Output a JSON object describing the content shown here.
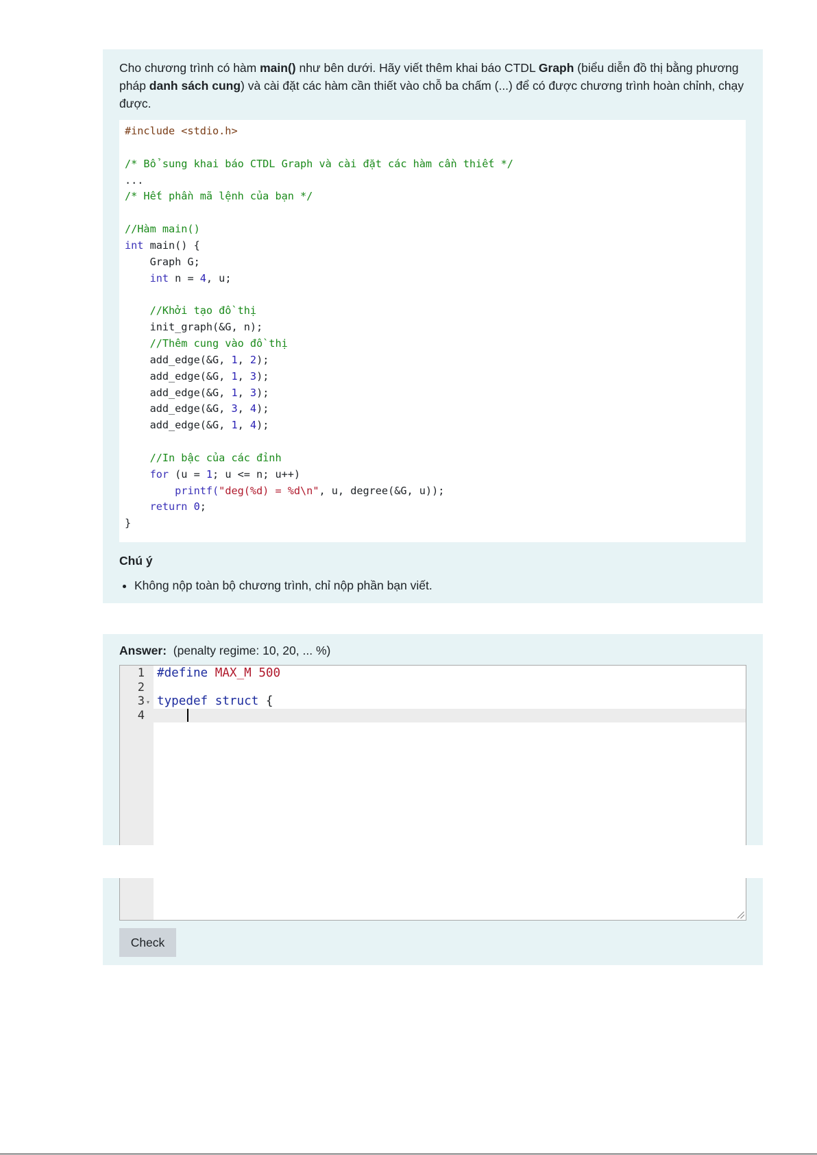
{
  "question": {
    "intro": {
      "p1": "Cho chương trình có hàm ",
      "b1": "main()",
      "p2": " như bên dưới. Hãy viết thêm khai báo CTDL ",
      "b2": "Graph",
      "p3": " (biểu diễn đồ thị bằng phương pháp ",
      "b3": "danh sách cung",
      "p4": ") và cài đặt các hàm cần thiết vào chỗ ba chấm (...) để có được chương trình hoàn chỉnh, chạy được."
    },
    "code": {
      "l1": "#include <stdio.h>",
      "l3": "/* Bổ sung khai báo CTDL Graph và cài đặt các hàm cần thiết */",
      "l4": "...",
      "l5": "/* Hết phần mã lệnh của bạn */",
      "l7": "//Hàm main()",
      "l8_kw": "int",
      "l8_rest": " main() {",
      "l9": "    Graph G;",
      "l10_kw": "int",
      "l10_a": " n = ",
      "l10_n": "4",
      "l10_b": ", u;",
      "l12": "//Khởi tạo đồ thị",
      "l13": "    init_graph(&G, n);",
      "l14": "//Thêm cung vào đồ thị",
      "edges": [
        {
          "a": "1",
          "b": "2"
        },
        {
          "a": "1",
          "b": "3"
        },
        {
          "a": "1",
          "b": "3"
        },
        {
          "a": "3",
          "b": "4"
        },
        {
          "a": "1",
          "b": "4"
        }
      ],
      "edge_prefix": "    add_edge(&G, ",
      "edge_sep": ", ",
      "edge_suffix": ");",
      "l21": "//In bậc của các đỉnh",
      "l22_kw": "for",
      "l22_a": " (u = ",
      "l22_n": "1",
      "l22_b": "; u <= n; u++)",
      "l23_fn": "printf(",
      "l23_str": "\"deg(%d) = %d\\n\"",
      "l23_rest": ", u, degree(&G, u));",
      "l24_kw": "return",
      "l24_n": "0",
      "l24_rest": ";",
      "l25": "}"
    },
    "note_title": "Chú ý",
    "note_items": [
      "Không nộp toàn bộ chương trình, chỉ nộp phần bạn viết."
    ]
  },
  "answer": {
    "label": "Answer:",
    "penalty": "(penalty regime: 10, 20, ... %)",
    "line_numbers": [
      "1",
      "2",
      "3",
      "4"
    ],
    "line1_pp": "#define",
    "line1_id": "MAX_M",
    "line1_num": "500",
    "line3_kw1": "typedef",
    "line3_kw2": "struct",
    "line3_rest": " {",
    "check_label": "Check"
  }
}
